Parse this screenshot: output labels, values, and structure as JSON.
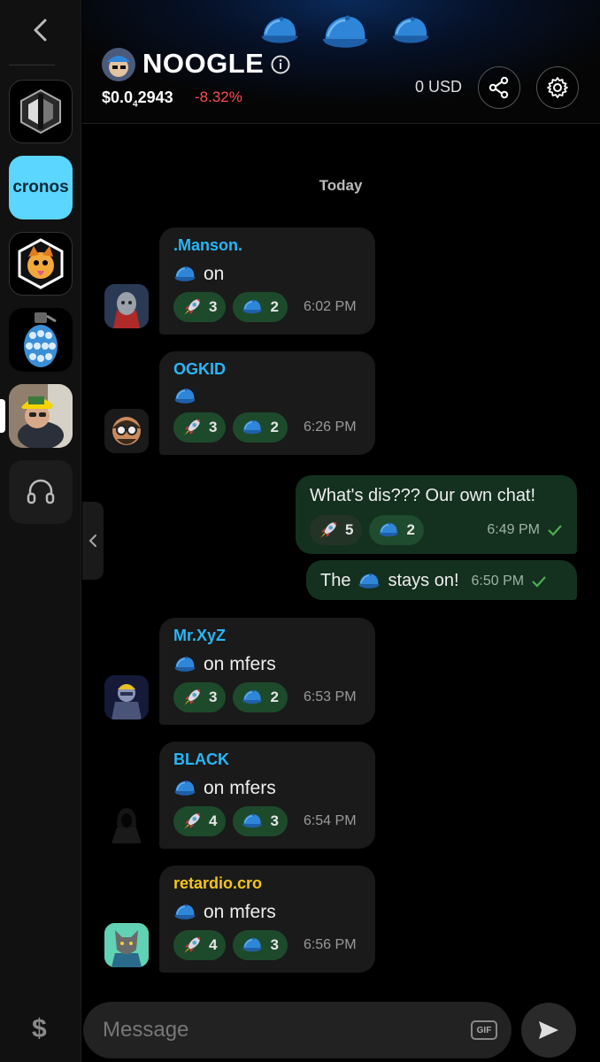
{
  "sidebar": {
    "cronos_label": "cronos",
    "dollar_label": "$"
  },
  "header": {
    "token_name": "NOOGLE",
    "price_prefix": "$0.0",
    "price_sub": "4",
    "price_suffix": "2943",
    "change": "-8.32%",
    "balance": "0 USD"
  },
  "chat": {
    "day_label": "Today",
    "messages": [
      {
        "sender": ".Manson.",
        "sender_color": "#29b6f6",
        "text": "on",
        "rocket": "3",
        "cap": "2",
        "time": "6:02 PM"
      },
      {
        "sender": "OGKID",
        "sender_color": "#29b6f6",
        "text": "",
        "rocket": "3",
        "cap": "2",
        "time": "6:26 PM"
      },
      {
        "text": "What's dis??? Our own chat!",
        "rocket": "5",
        "cap": "2",
        "time": "6:49 PM"
      },
      {
        "text_before": "The",
        "text_after": "stays on!",
        "time": "6:50 PM"
      },
      {
        "sender": "Mr.XyZ",
        "sender_color": "#29b6f6",
        "text": "on mfers",
        "rocket": "3",
        "cap": "2",
        "time": "6:53 PM"
      },
      {
        "sender": "BLACK",
        "sender_color": "#29b6f6",
        "text": "on mfers",
        "rocket": "4",
        "cap": "3",
        "time": "6:54 PM"
      },
      {
        "sender": "retardio.cro",
        "sender_color": "#f5c518",
        "text": "on mfers",
        "rocket": "4",
        "cap": "3",
        "time": "6:56 PM"
      }
    ]
  },
  "composer": {
    "placeholder": "Message",
    "gif_label": "GIF"
  },
  "colors": {
    "accent_blue": "#29b6f6",
    "negative": "#ff4d4f",
    "outgoing_bubble": "#14301f"
  },
  "icons": [
    "back-icon",
    "info-icon",
    "share-icon",
    "gear-icon",
    "headset-icon",
    "collapse-chevron-icon",
    "gif-icon",
    "send-icon",
    "rocket-emoji",
    "cap-emoji",
    "check-icon"
  ]
}
